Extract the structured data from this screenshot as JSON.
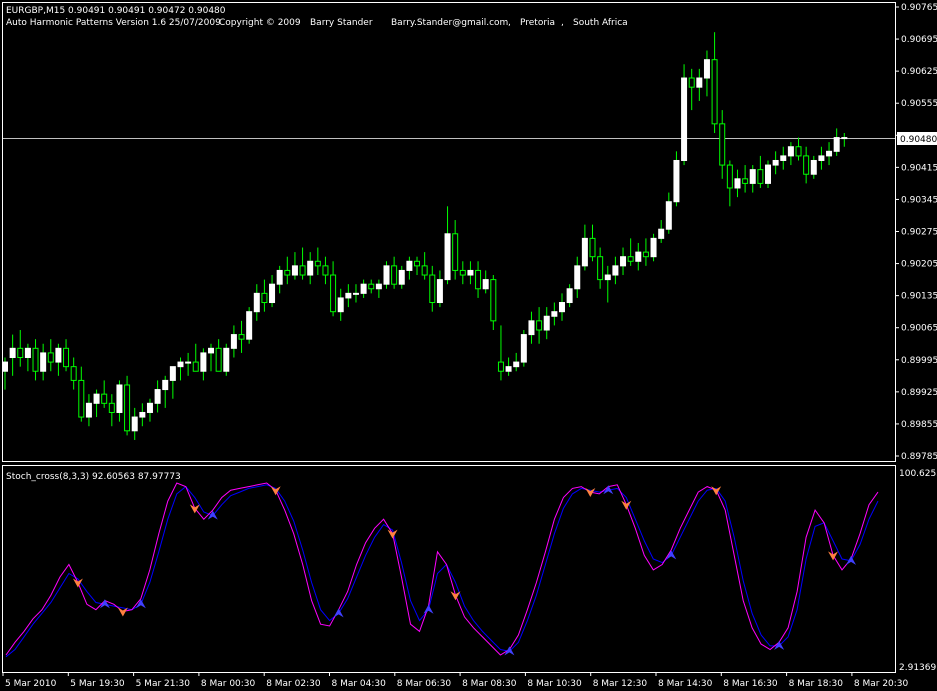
{
  "header": {
    "symbol_line": "EURGBP,M15  0.90491 0.90491 0.90472 0.90480",
    "indicator_name": "Auto Harmonic Patterns Version 1.6 25/07/2009",
    "copyright": "Copyright © 2009",
    "author": "Barry Stander",
    "email": "Barry.Stander@gmail.com",
    "sep1": ",",
    "city": "Pretoria",
    "sep2": ",",
    "country": "South Africa"
  },
  "subwindow": {
    "title": "Stoch_cross(8,3,3) 92.60563 87.97773",
    "scale_top": "100.6253",
    "scale_bottom": "2.91369"
  },
  "colors": {
    "background": "#000000",
    "bull_body": "#ffffff",
    "bull_wick": "#00ff00",
    "bear_body": "#000000",
    "bear_wick": "#00ff00",
    "price_line": "#c0c0c0",
    "frame": "#ffffff",
    "stoch_main": "#ff00ff",
    "stoch_signal": "#0000ff",
    "arrow_up": "#4040ff",
    "arrow_down": "#ff8040"
  },
  "price_axis_labels": [
    "0.90765",
    "0.90695",
    "0.90625",
    "0.90555",
    "0.90480",
    "0.90415",
    "0.90345",
    "0.90275",
    "0.90205",
    "0.90135",
    "0.90065",
    "0.89995",
    "0.89925",
    "0.89855",
    "0.89785"
  ],
  "current_price": "0.90480",
  "time_axis_labels": [
    "5 Mar 2010",
    "5 Mar 19:30",
    "5 Mar 21:30",
    "8 Mar 00:30",
    "8 Mar 02:30",
    "8 Mar 04:30",
    "8 Mar 06:30",
    "8 Mar 08:30",
    "8 Mar 10:30",
    "8 Mar 12:30",
    "8 Mar 14:30",
    "8 Mar 16:30",
    "8 Mar 18:30",
    "8 Mar 20:30"
  ],
  "chart_data": {
    "type": "candlestick",
    "symbol": "EURGBP",
    "timeframe": "M15",
    "ylim": [
      0.89785,
      0.90765
    ],
    "candles": [
      [
        0.8997,
        0.9,
        0.8993,
        0.8999
      ],
      [
        0.9,
        0.9005,
        0.8996,
        0.9002
      ],
      [
        0.9002,
        0.9006,
        0.8998,
        0.9
      ],
      [
        0.9,
        0.9003,
        0.8997,
        0.9002
      ],
      [
        0.9002,
        0.9004,
        0.8995,
        0.8997
      ],
      [
        0.8997,
        0.9003,
        0.8995,
        0.9001
      ],
      [
        0.9001,
        0.9004,
        0.8997,
        0.8999
      ],
      [
        0.8999,
        0.9003,
        0.8996,
        0.9002
      ],
      [
        0.9002,
        0.9004,
        0.8997,
        0.8998
      ],
      [
        0.8998,
        0.9,
        0.8993,
        0.8995
      ],
      [
        0.8995,
        0.8998,
        0.8986,
        0.8987
      ],
      [
        0.8987,
        0.8992,
        0.8985,
        0.899
      ],
      [
        0.899,
        0.8993,
        0.8987,
        0.8992
      ],
      [
        0.8992,
        0.8995,
        0.8989,
        0.899
      ],
      [
        0.899,
        0.8992,
        0.8985,
        0.8988
      ],
      [
        0.8988,
        0.8995,
        0.8986,
        0.8994
      ],
      [
        0.8994,
        0.8996,
        0.8983,
        0.8984
      ],
      [
        0.8984,
        0.8989,
        0.8982,
        0.8987
      ],
      [
        0.8987,
        0.899,
        0.8985,
        0.8988
      ],
      [
        0.8988,
        0.8991,
        0.8986,
        0.899
      ],
      [
        0.899,
        0.8995,
        0.8988,
        0.8993
      ],
      [
        0.8993,
        0.8996,
        0.8989,
        0.8995
      ],
      [
        0.8995,
        0.8998,
        0.8991,
        0.8998
      ],
      [
        0.8998,
        0.9,
        0.8995,
        0.8999
      ],
      [
        0.8999,
        0.9001,
        0.8996,
        0.8999
      ],
      [
        0.8999,
        0.9003,
        0.8997,
        0.8997
      ],
      [
        0.8997,
        0.9002,
        0.8995,
        0.9001
      ],
      [
        0.9001,
        0.9003,
        0.8997,
        0.9002
      ],
      [
        0.9002,
        0.9004,
        0.8998,
        0.8997
      ],
      [
        0.8997,
        0.9003,
        0.8996,
        0.9002
      ],
      [
        0.9002,
        0.9007,
        0.9,
        0.9005
      ],
      [
        0.9005,
        0.9008,
        0.9001,
        0.9004
      ],
      [
        0.9004,
        0.9011,
        0.9003,
        0.901
      ],
      [
        0.901,
        0.9016,
        0.9008,
        0.9014
      ],
      [
        0.9014,
        0.9017,
        0.901,
        0.9012
      ],
      [
        0.9012,
        0.9018,
        0.9011,
        0.9016
      ],
      [
        0.9016,
        0.902,
        0.9014,
        0.9019
      ],
      [
        0.9019,
        0.9022,
        0.9016,
        0.9018
      ],
      [
        0.9018,
        0.9023,
        0.9017,
        0.902
      ],
      [
        0.902,
        0.9024,
        0.9017,
        0.9018
      ],
      [
        0.9018,
        0.9023,
        0.9016,
        0.9021
      ],
      [
        0.9021,
        0.9024,
        0.9018,
        0.902
      ],
      [
        0.902,
        0.9022,
        0.9016,
        0.9018
      ],
      [
        0.9018,
        0.9021,
        0.9009,
        0.901
      ],
      [
        0.901,
        0.9015,
        0.9008,
        0.9013
      ],
      [
        0.9013,
        0.9016,
        0.9011,
        0.9014
      ],
      [
        0.9014,
        0.9016,
        0.9012,
        0.9014
      ],
      [
        0.9014,
        0.9017,
        0.9013,
        0.9016
      ],
      [
        0.9016,
        0.9017,
        0.9014,
        0.9015
      ],
      [
        0.9015,
        0.9017,
        0.9013,
        0.9016
      ],
      [
        0.9016,
        0.9021,
        0.9015,
        0.902
      ],
      [
        0.902,
        0.9022,
        0.9015,
        0.9016
      ],
      [
        0.9016,
        0.902,
        0.9015,
        0.9019
      ],
      [
        0.9019,
        0.9022,
        0.9017,
        0.9021
      ],
      [
        0.9021,
        0.9022,
        0.9018,
        0.902
      ],
      [
        0.902,
        0.9023,
        0.9017,
        0.9018
      ],
      [
        0.9018,
        0.902,
        0.901,
        0.9012
      ],
      [
        0.9012,
        0.9019,
        0.9011,
        0.9017
      ],
      [
        0.9017,
        0.9033,
        0.9016,
        0.9027
      ],
      [
        0.9027,
        0.903,
        0.9017,
        0.9019
      ],
      [
        0.9019,
        0.9021,
        0.9016,
        0.9018
      ],
      [
        0.9018,
        0.9021,
        0.9016,
        0.9019
      ],
      [
        0.9019,
        0.9021,
        0.9013,
        0.9015
      ],
      [
        0.9015,
        0.9019,
        0.9014,
        0.9017
      ],
      [
        0.9017,
        0.9018,
        0.9006,
        0.9008
      ],
      [
        0.8999,
        0.9007,
        0.8995,
        0.8997
      ],
      [
        0.8997,
        0.9,
        0.8996,
        0.8998
      ],
      [
        0.8998,
        0.9001,
        0.8997,
        0.8999
      ],
      [
        0.8999,
        0.9006,
        0.8998,
        0.9005
      ],
      [
        0.9005,
        0.901,
        0.9003,
        0.9008
      ],
      [
        0.9008,
        0.9011,
        0.9003,
        0.9006
      ],
      [
        0.9006,
        0.9011,
        0.9004,
        0.9009
      ],
      [
        0.9009,
        0.9012,
        0.9007,
        0.901
      ],
      [
        0.901,
        0.9014,
        0.9008,
        0.9012
      ],
      [
        0.9012,
        0.9016,
        0.9011,
        0.9015
      ],
      [
        0.9015,
        0.9022,
        0.9013,
        0.902
      ],
      [
        0.902,
        0.9029,
        0.9019,
        0.9026
      ],
      [
        0.9026,
        0.9029,
        0.9021,
        0.9022
      ],
      [
        0.9022,
        0.9024,
        0.9015,
        0.9017
      ],
      [
        0.9017,
        0.902,
        0.9012,
        0.9018
      ],
      [
        0.9018,
        0.9022,
        0.9016,
        0.902
      ],
      [
        0.902,
        0.9024,
        0.9018,
        0.9022
      ],
      [
        0.9022,
        0.9026,
        0.902,
        0.9021
      ],
      [
        0.9021,
        0.9025,
        0.9019,
        0.9023
      ],
      [
        0.9023,
        0.9026,
        0.902,
        0.9022
      ],
      [
        0.9022,
        0.9027,
        0.9021,
        0.9026
      ],
      [
        0.9026,
        0.903,
        0.9025,
        0.9028
      ],
      [
        0.9028,
        0.9036,
        0.9027,
        0.9034
      ],
      [
        0.9034,
        0.9045,
        0.9033,
        0.9043
      ],
      [
        0.9043,
        0.9064,
        0.9042,
        0.9061
      ],
      [
        0.9061,
        0.9063,
        0.9054,
        0.9059
      ],
      [
        0.9059,
        0.9063,
        0.9056,
        0.9061
      ],
      [
        0.9061,
        0.9067,
        0.9057,
        0.9065
      ],
      [
        0.9065,
        0.9071,
        0.9049,
        0.9051
      ],
      [
        0.9051,
        0.9054,
        0.9039,
        0.9042
      ],
      [
        0.9042,
        0.9043,
        0.9033,
        0.9037
      ],
      [
        0.9037,
        0.9041,
        0.9035,
        0.9039
      ],
      [
        0.9039,
        0.9042,
        0.9036,
        0.9038
      ],
      [
        0.9038,
        0.9042,
        0.9036,
        0.9041
      ],
      [
        0.9041,
        0.9044,
        0.9037,
        0.9038
      ],
      [
        0.9038,
        0.9043,
        0.9037,
        0.9042
      ],
      [
        0.9042,
        0.9045,
        0.904,
        0.9043
      ],
      [
        0.9043,
        0.9046,
        0.9041,
        0.9044
      ],
      [
        0.9044,
        0.9047,
        0.9042,
        0.9046
      ],
      [
        0.9046,
        0.9048,
        0.9043,
        0.9044
      ],
      [
        0.9044,
        0.9046,
        0.9038,
        0.904
      ],
      [
        0.904,
        0.9044,
        0.9039,
        0.9043
      ],
      [
        0.9043,
        0.9046,
        0.9041,
        0.9044
      ],
      [
        0.9044,
        0.9047,
        0.9042,
        0.9045
      ],
      [
        0.9045,
        0.905,
        0.9044,
        0.9048
      ],
      [
        0.9048,
        0.9049,
        0.9046,
        0.9048
      ]
    ],
    "stochastic": {
      "name": "Stoch_cross(8,3,3)",
      "ylim": [
        2.91369,
        100.6253
      ],
      "main": [
        5,
        12,
        18,
        25,
        30,
        38,
        48,
        55,
        45,
        33,
        30,
        35,
        33,
        29,
        30,
        36,
        52,
        72,
        90,
        100,
        98,
        86,
        80,
        85,
        92,
        96,
        97,
        98,
        99,
        100,
        96,
        85,
        72,
        55,
        35,
        22,
        21,
        30,
        40,
        55,
        67,
        75,
        80,
        72,
        48,
        22,
        18,
        32,
        62,
        55,
        38,
        26,
        20,
        15,
        10,
        5,
        8,
        16,
        30,
        45,
        62,
        80,
        92,
        97,
        98,
        95,
        94,
        98,
        99,
        88,
        75,
        60,
        52,
        55,
        63,
        75,
        85,
        95,
        98,
        96,
        85,
        60,
        35,
        20,
        11,
        8,
        12,
        20,
        40,
        70,
        85,
        78,
        60,
        52,
        58,
        72,
        88,
        95
      ],
      "signal": [
        4,
        8,
        15,
        22,
        28,
        34,
        42,
        50,
        47,
        40,
        34,
        33,
        32,
        31,
        30,
        33,
        45,
        62,
        80,
        94,
        98,
        92,
        84,
        82,
        88,
        93,
        95,
        97,
        98,
        99,
        97,
        90,
        79,
        63,
        45,
        30,
        24,
        28,
        36,
        48,
        60,
        70,
        77,
        74,
        56,
        35,
        24,
        30,
        50,
        55,
        45,
        32,
        24,
        18,
        13,
        8,
        7,
        12,
        24,
        38,
        55,
        72,
        86,
        94,
        97,
        96,
        95,
        96,
        97,
        92,
        80,
        68,
        58,
        56,
        60,
        70,
        80,
        90,
        96,
        97,
        90,
        70,
        46,
        28,
        16,
        10,
        10,
        15,
        30,
        58,
        76,
        78,
        68,
        58,
        57,
        66,
        80,
        90
      ]
    }
  }
}
